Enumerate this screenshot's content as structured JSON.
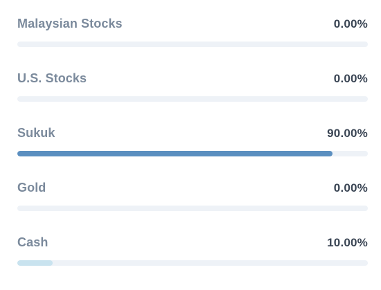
{
  "allocations": [
    {
      "label": "Malaysian Stocks",
      "percent_text": "0.00%",
      "value": 0.0,
      "color": "#5b8fc0"
    },
    {
      "label": "U.S. Stocks",
      "percent_text": "0.00%",
      "value": 0.0,
      "color": "#5b8fc0"
    },
    {
      "label": "Sukuk",
      "percent_text": "90.00%",
      "value": 90.0,
      "color": "#5b8fc0"
    },
    {
      "label": "Gold",
      "percent_text": "0.00%",
      "value": 0.0,
      "color": "#5b8fc0"
    },
    {
      "label": "Cash",
      "percent_text": "10.00%",
      "value": 10.0,
      "color": "#c9e3ef"
    }
  ]
}
